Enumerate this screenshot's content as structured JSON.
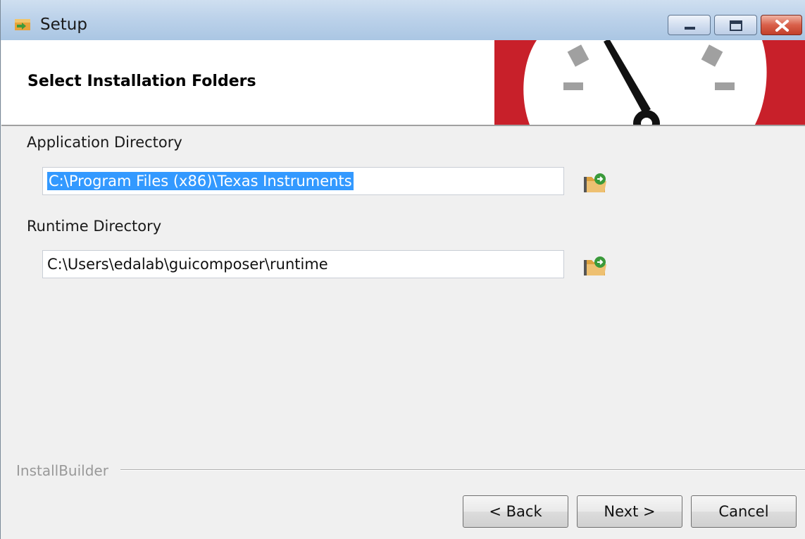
{
  "window": {
    "title": "Setup",
    "controls": {
      "minimize": "minimize-icon",
      "maximize": "maximize-icon",
      "close": "close-icon"
    }
  },
  "header": {
    "title": "Select Installation Folders"
  },
  "fields": {
    "application": {
      "label": "Application Directory",
      "value": "C:\\Program Files (x86)\\Texas Instruments",
      "selected": true
    },
    "runtime": {
      "label": "Runtime Directory",
      "value": "C:\\Users\\edalab\\guicomposer\\runtime"
    }
  },
  "footer": {
    "brand": "InstallBuilder",
    "buttons": {
      "back": "< Back",
      "next": "Next >",
      "cancel": "Cancel"
    }
  },
  "colors": {
    "banner_red": "#c8202a",
    "selection": "#3399ff",
    "titlebar": "#bcd2ea"
  }
}
